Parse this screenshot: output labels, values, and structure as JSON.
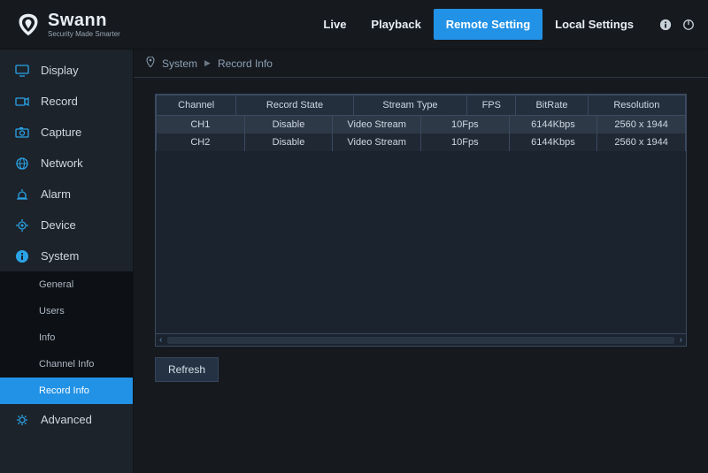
{
  "brand": {
    "name": "Swann",
    "tagline": "Security Made Smarter"
  },
  "nav": {
    "live": "Live",
    "playback": "Playback",
    "remote": "Remote Setting",
    "local": "Local Settings"
  },
  "sidebar": {
    "display": "Display",
    "record": "Record",
    "capture": "Capture",
    "network": "Network",
    "alarm": "Alarm",
    "device": "Device",
    "system": "System",
    "advanced": "Advanced"
  },
  "system_submenu": {
    "general": "General",
    "users": "Users",
    "info": "Info",
    "channel_info": "Channel Info",
    "record_info": "Record Info"
  },
  "breadcrumb": {
    "root": "System",
    "page": "Record Info"
  },
  "table": {
    "headers": {
      "channel": "Channel",
      "record_state": "Record State",
      "stream_type": "Stream Type",
      "fps": "FPS",
      "bitrate": "BitRate",
      "resolution": "Resolution"
    },
    "rows": [
      {
        "channel": "CH1",
        "record_state": "Disable",
        "stream_type": "Video Stream",
        "fps": "10Fps",
        "bitrate": "6144Kbps",
        "resolution": "2560 x 1944"
      },
      {
        "channel": "CH2",
        "record_state": "Disable",
        "stream_type": "Video Stream",
        "fps": "10Fps",
        "bitrate": "6144Kbps",
        "resolution": "2560 x 1944"
      }
    ]
  },
  "buttons": {
    "refresh": "Refresh"
  }
}
